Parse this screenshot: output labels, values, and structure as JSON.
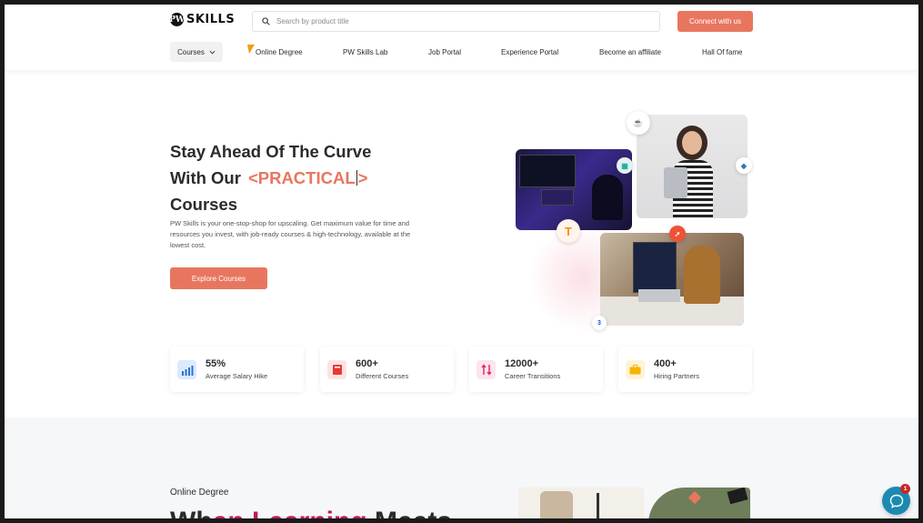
{
  "header": {
    "logo_text": "SKILLS",
    "logo_mark": "PW",
    "search_placeholder": "Search by product title",
    "connect_label": "Connect with us"
  },
  "nav": {
    "courses": "Courses",
    "online_degree": "Online Degree",
    "lab": "PW Skills Lab",
    "job_portal": "Job Portal",
    "experience_portal": "Experience Portal",
    "affiliate": "Become an affiliate",
    "hall_of_fame": "Hall Of fame"
  },
  "hero": {
    "line1": "Stay Ahead Of The Curve",
    "line2": "With Our",
    "accent_prefix": "<PRACTICAL",
    "accent_suffix": ">",
    "line3": "Courses",
    "description": "PW Skills is your one-stop-shop for upscaling. Get maximum value for time and resources you invest, with job-ready courses & high-technology, available at the lowest cost.",
    "cta": "Explore Courses"
  },
  "stats": [
    {
      "value": "55%",
      "label": "Average Salary Hike",
      "icon": "growth-chart-icon",
      "color": "#dbeafe"
    },
    {
      "value": "600+",
      "label": "Different Courses",
      "icon": "book-icon",
      "color": "#fde2e2"
    },
    {
      "value": "12000+",
      "label": "Career Transitions",
      "icon": "transition-arrows-icon",
      "color": "#fde4ee"
    },
    {
      "value": "400+",
      "label": "Hiring Partners",
      "icon": "briefcase-icon",
      "color": "#fdf3d6"
    }
  ],
  "lower": {
    "section_label": "Online Degree",
    "heading_start": "Wh",
    "heading_pink": "en Learning",
    "heading_end": " Meets"
  },
  "chat": {
    "unread": "1"
  },
  "colors": {
    "accent": "#e8765f",
    "text": "#2b2b2b",
    "chat": "#1b8ab1"
  }
}
